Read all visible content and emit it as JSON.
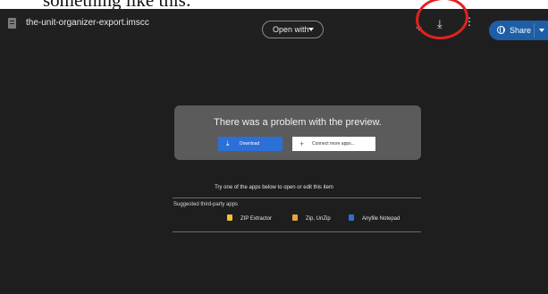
{
  "caption": "something like this:",
  "header": {
    "filename": "the-unit-organizer-export.imscc",
    "open_with_label": "Open with",
    "share_label": "Share",
    "icons": [
      "add-icon",
      "download-icon",
      "more-icon"
    ]
  },
  "preview": {
    "message": "There was a problem with the preview.",
    "download_label": "Download",
    "connect_label": "Connect more apps..."
  },
  "apps_section": {
    "prompt": "Try one of the apps below to open or edit this item",
    "suggested_label": "Suggested third-party apps",
    "apps": [
      {
        "name": "ZIP Extractor",
        "color": "#f2c230"
      },
      {
        "name": "Zip, UnZip",
        "color": "#e7a53b"
      },
      {
        "name": "Anyfile Notepad",
        "color": "#2f6fd1"
      }
    ]
  },
  "colors": {
    "background": "#1e1e1e",
    "panel": "#5b5b5b",
    "primary_button": "#2c6fd6",
    "share_button": "#1d5ea6",
    "annotation": "#e4211f"
  }
}
